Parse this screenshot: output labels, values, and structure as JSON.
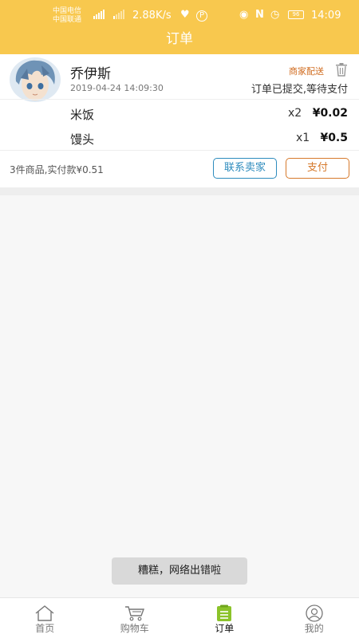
{
  "status_bar": {
    "carrier_1": "中国电信",
    "carrier_2": "中国联通",
    "speed": "2.88K/s",
    "battery": "96",
    "time": "14:09"
  },
  "header": {
    "title": "订单"
  },
  "order": {
    "buyer_name": "乔伊斯",
    "date": "2019-04-24 14:09:30",
    "delivery": "商家配送",
    "status": "订单已提交,等待支付",
    "items": [
      {
        "name": "米饭",
        "qty": "x2",
        "price": "¥0.02"
      },
      {
        "name": "馒头",
        "qty": "x1",
        "price": "¥0.5"
      }
    ],
    "summary": "3件商品,实付款¥0.51",
    "contact_label": "联系卖家",
    "pay_label": "支付"
  },
  "toast": {
    "message": "糟糕，网络出错啦"
  },
  "tabs": [
    {
      "label": "首页",
      "icon": "home-icon"
    },
    {
      "label": "购物车",
      "icon": "cart-icon"
    },
    {
      "label": "订单",
      "icon": "order-list-icon",
      "active": true
    },
    {
      "label": "我的",
      "icon": "profile-icon"
    }
  ],
  "colors": {
    "header": "#f8c84e",
    "accent_orange": "#d6792b",
    "accent_blue": "#2d8bbd",
    "active_tab": "#8bc32a"
  }
}
